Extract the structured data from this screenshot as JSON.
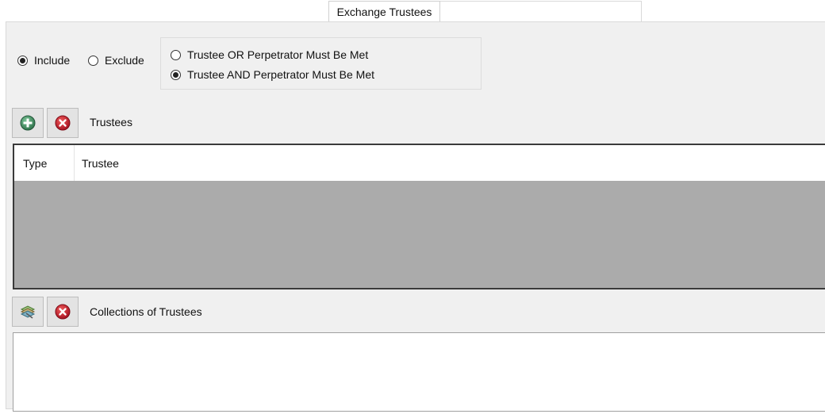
{
  "tab": {
    "title": "Exchange Trustees"
  },
  "mode": {
    "include_label": "Include",
    "exclude_label": "Exclude",
    "selected": "include"
  },
  "condition": {
    "or_label": "Trustee OR Perpetrator Must Be Met",
    "and_label": "Trustee AND Perpetrator Must Be Met",
    "selected": "and"
  },
  "trustees": {
    "label": "Trustees",
    "add_icon": "add-circle-icon",
    "remove_icon": "remove-circle-icon",
    "columns": [
      "Type",
      "Trustee"
    ],
    "rows": []
  },
  "collections": {
    "label": "Collections of Trustees",
    "add_icon": "collection-add-icon",
    "remove_icon": "remove-circle-icon",
    "items": []
  },
  "colors": {
    "panel_bg": "#f0f0f0",
    "grid_empty_bg": "#ababab",
    "add_green": "#3d8f5c",
    "remove_red": "#c8102e"
  }
}
